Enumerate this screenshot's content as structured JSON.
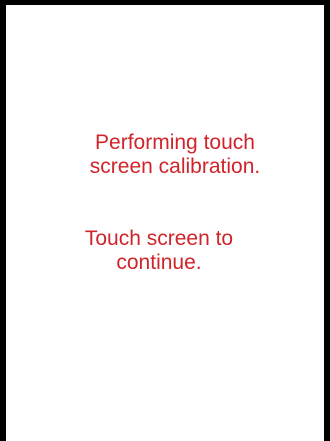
{
  "calibration_screen": {
    "line1": "Performing touch",
    "line2": "screen calibration.",
    "line3": "Touch screen to",
    "line4": "continue."
  },
  "colors": {
    "text": "#d0242b",
    "frame": "#000000",
    "background": "#ffffff"
  }
}
